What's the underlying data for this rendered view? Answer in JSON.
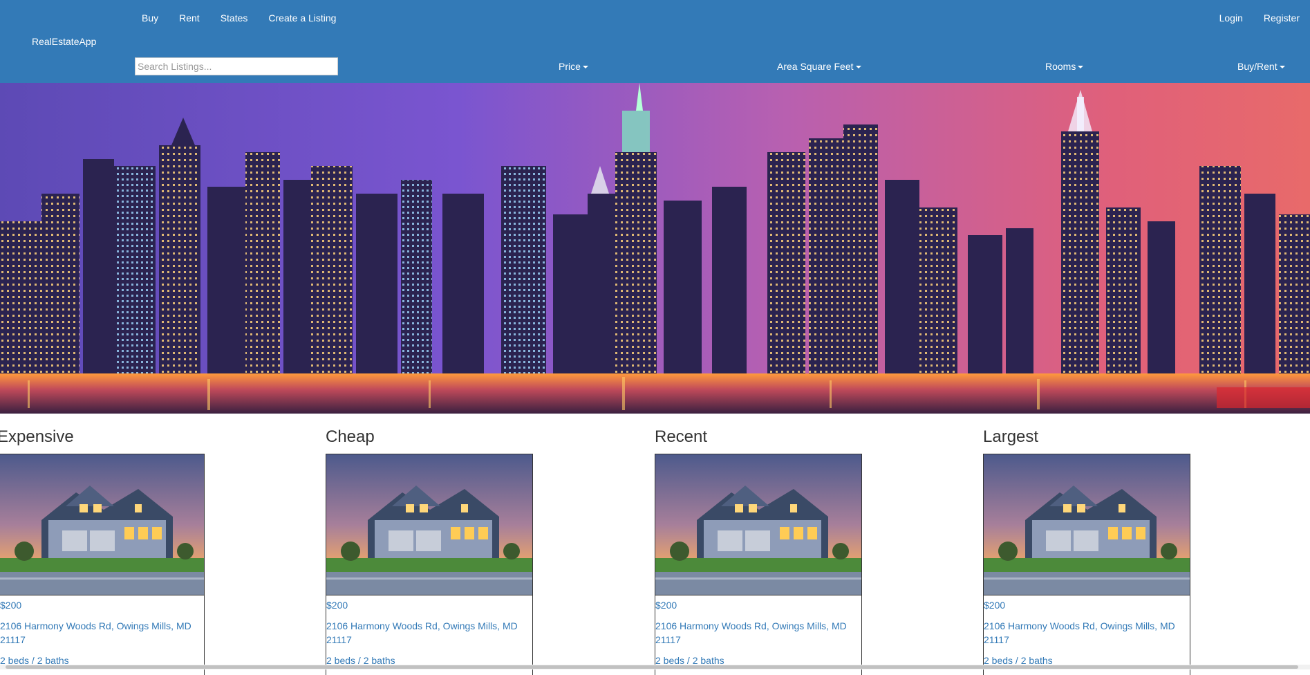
{
  "nav": {
    "links_left": [
      "Buy",
      "Rent",
      "States",
      "Create a Listing"
    ],
    "links_right": [
      "Login",
      "Register"
    ],
    "brand": "RealEstateApp",
    "search_placeholder": "Search Listings...",
    "filters": [
      "Price",
      "Area Square Feet",
      "Rooms",
      "Buy/Rent"
    ],
    "color": "#337ab7"
  },
  "hero": {
    "image": "city-skyline-night"
  },
  "sections": [
    {
      "title": "Expensive",
      "price": "$200",
      "address": "2106 Harmony Woods Rd, Owings Mills, MD 21117",
      "rooms": "2 beds / 2 baths"
    },
    {
      "title": "Cheap",
      "price": "$200",
      "address": "2106 Harmony Woods Rd, Owings Mills, MD 21117",
      "rooms": "2 beds / 2 baths"
    },
    {
      "title": "Recent",
      "price": "$200",
      "address": "2106 Harmony Woods Rd, Owings Mills, MD 21117",
      "rooms": "2 beds / 2 baths"
    },
    {
      "title": "Largest",
      "price": "$200",
      "address": "2106 Harmony Woods Rd, Owings Mills, MD 21117",
      "rooms": "2 beds / 2 baths"
    }
  ]
}
